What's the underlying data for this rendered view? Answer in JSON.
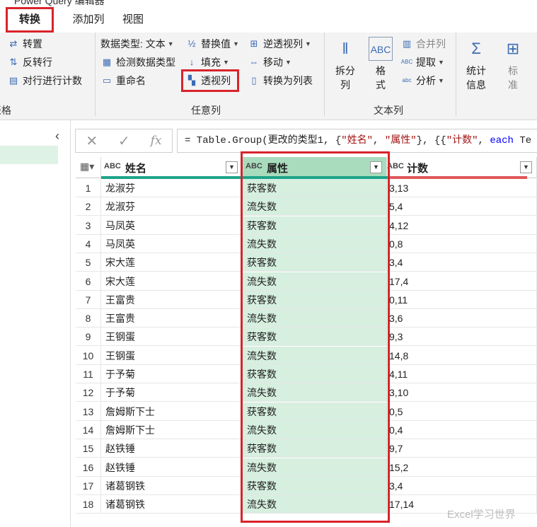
{
  "window": {
    "title": "Power Query 编辑器"
  },
  "tabs": [
    {
      "label": "转换",
      "selected": true
    },
    {
      "label": "添加列",
      "selected": false
    },
    {
      "label": "视图",
      "selected": false
    }
  ],
  "ribbon": {
    "table_group": {
      "label": "表格",
      "items": [
        "转置",
        "反转行",
        "对行进行计数"
      ]
    },
    "any_column_group": {
      "label": "任意列",
      "data_type": "数据类型: 文本",
      "detect_type": "检测数据类型",
      "rename": "重命名",
      "replace_values": "替换值",
      "fill": "填充",
      "pivot_column": "透视列",
      "unpivot_columns": "逆透视列",
      "move": "移动",
      "convert_to_list": "转换为列表"
    },
    "text_column_group": {
      "label": "文本列",
      "split": "拆分列",
      "format": "格式",
      "merge_columns": "合并列",
      "extract": "提取",
      "parse": "分析"
    },
    "number_group": {
      "statistics": "统计信息",
      "standard": "标准"
    }
  },
  "formula": {
    "prefix": "= Table.Group(更改的类型1, {",
    "s1": "\"姓名\"",
    "m1": ", ",
    "s2": "\"属性\"",
    "m2": "}, {{",
    "s3": "\"计数\"",
    "m3": ", ",
    "kw": "each",
    "tail": " Te"
  },
  "table": {
    "columns": [
      {
        "type": "ABC",
        "name": "姓名",
        "bar_color": "#1ea48a"
      },
      {
        "type": "ABC",
        "name": "属性",
        "bar_color": "#1ea48a"
      },
      {
        "type": "ABC",
        "name": "计数",
        "bar_color": "#e0585c"
      }
    ],
    "rows": [
      {
        "n": "1",
        "name": "龙淑芬",
        "attr": "获客数",
        "count": "3,13"
      },
      {
        "n": "2",
        "name": "龙淑芬",
        "attr": "流失数",
        "count": "5,4"
      },
      {
        "n": "3",
        "name": "马凤英",
        "attr": "获客数",
        "count": "4,12"
      },
      {
        "n": "4",
        "name": "马凤英",
        "attr": "流失数",
        "count": "0,8"
      },
      {
        "n": "5",
        "name": "宋大莲",
        "attr": "获客数",
        "count": "3,4"
      },
      {
        "n": "6",
        "name": "宋大莲",
        "attr": "流失数",
        "count": "17,4"
      },
      {
        "n": "7",
        "name": "王富贵",
        "attr": "获客数",
        "count": "0,11"
      },
      {
        "n": "8",
        "name": "王富贵",
        "attr": "流失数",
        "count": "3,6"
      },
      {
        "n": "9",
        "name": "王钢蛋",
        "attr": "获客数",
        "count": "9,3"
      },
      {
        "n": "10",
        "name": "王钢蛋",
        "attr": "流失数",
        "count": "14,8"
      },
      {
        "n": "11",
        "name": "于予菊",
        "attr": "获客数",
        "count": "4,11"
      },
      {
        "n": "12",
        "name": "于予菊",
        "attr": "流失数",
        "count": "3,10"
      },
      {
        "n": "13",
        "name": "詹姆斯下士",
        "attr": "获客数",
        "count": "0,5"
      },
      {
        "n": "14",
        "name": "詹姆斯下士",
        "attr": "流失数",
        "count": "0,4"
      },
      {
        "n": "15",
        "name": "赵铁锤",
        "attr": "获客数",
        "count": "9,7"
      },
      {
        "n": "16",
        "name": "赵铁锤",
        "attr": "流失数",
        "count": "15,2"
      },
      {
        "n": "17",
        "name": "诸葛钢铁",
        "attr": "获客数",
        "count": "3,4"
      },
      {
        "n": "18",
        "name": "诸葛钢铁",
        "attr": "流失数",
        "count": "17,14"
      }
    ]
  },
  "watermark": "Excel学习世界",
  "colors": {
    "highlight": "#d9232b",
    "selected_column": "#d6efdf"
  }
}
